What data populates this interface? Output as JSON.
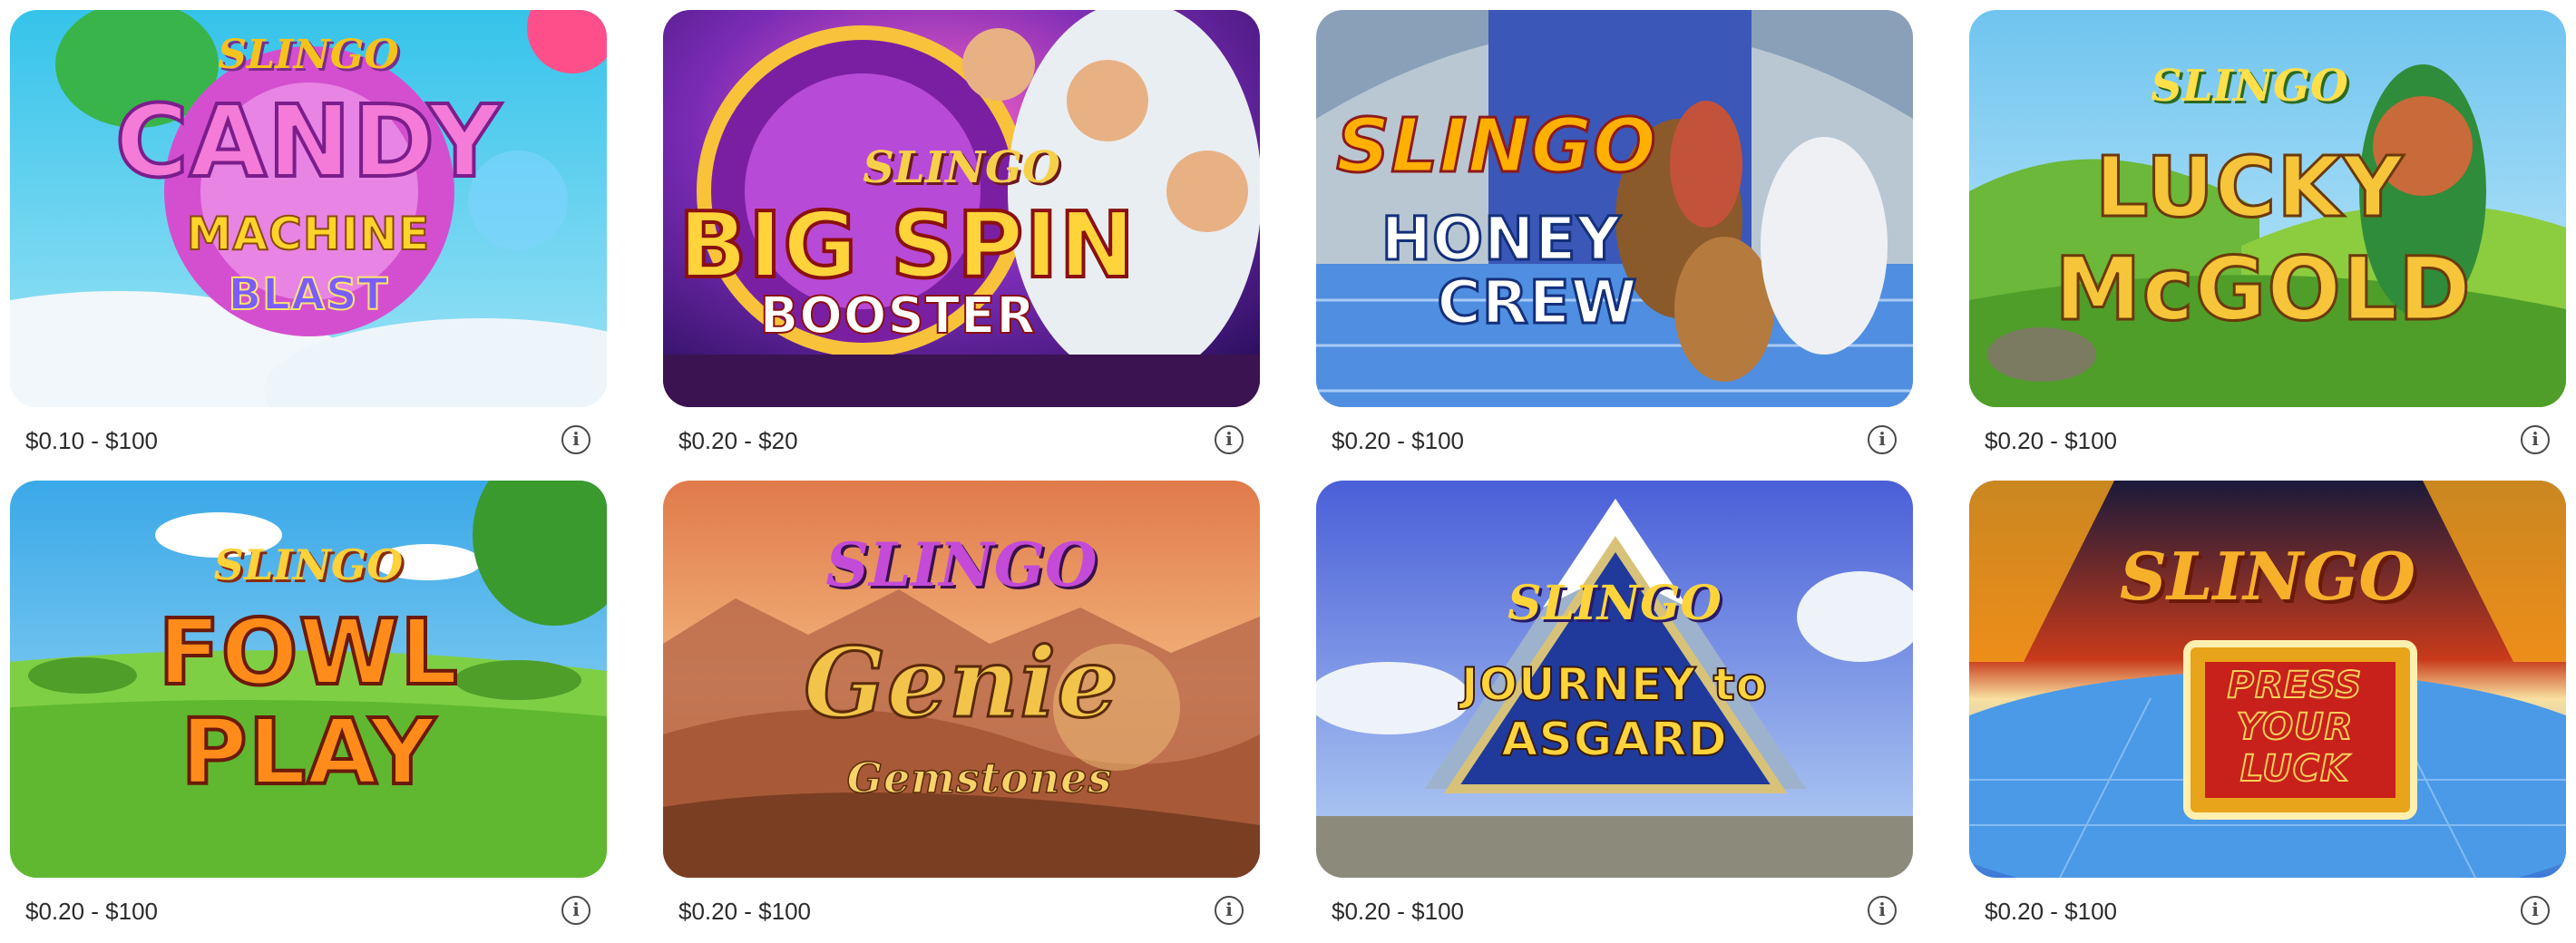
{
  "games": [
    {
      "logo_top": "SLINGO",
      "logo_main": "CANDY",
      "logo_sub": "MACHINE",
      "logo_sub2": "BLAST",
      "price": "$0.10 - $100",
      "info_icon": "i"
    },
    {
      "logo_top": "SLINGO",
      "logo_main": "BIG SPIN",
      "logo_sub": "BOOSTER",
      "price": "$0.20 - $20",
      "info_icon": "i"
    },
    {
      "logo_top": "SLINGO",
      "logo_main": "HONEY",
      "logo_sub": "CREW",
      "price": "$0.20 - $100",
      "info_icon": "i"
    },
    {
      "logo_top": "SLINGO",
      "logo_main": "LUCKY",
      "logo_sub": "McGOLD",
      "price": "$0.20 - $100",
      "info_icon": "i"
    },
    {
      "logo_top": "SLINGO",
      "logo_main": "FOWL",
      "logo_sub": "PLAY",
      "price": "$0.20 - $100",
      "info_icon": "i"
    },
    {
      "logo_top": "SLINGO",
      "logo_main": "Genie",
      "logo_sub": "Gemstones",
      "price": "$0.20 - $100",
      "info_icon": "i"
    },
    {
      "logo_top": "SLINGO",
      "logo_main": "JOURNEY to",
      "logo_sub": "ASGARD",
      "price": "$0.20 - $100",
      "info_icon": "i"
    },
    {
      "logo_top": "SLINGO",
      "logo_main": "PRESS",
      "logo_sub": "YOUR",
      "logo_sub2": "LUCK",
      "price": "$0.20 - $100",
      "info_icon": "i"
    }
  ]
}
